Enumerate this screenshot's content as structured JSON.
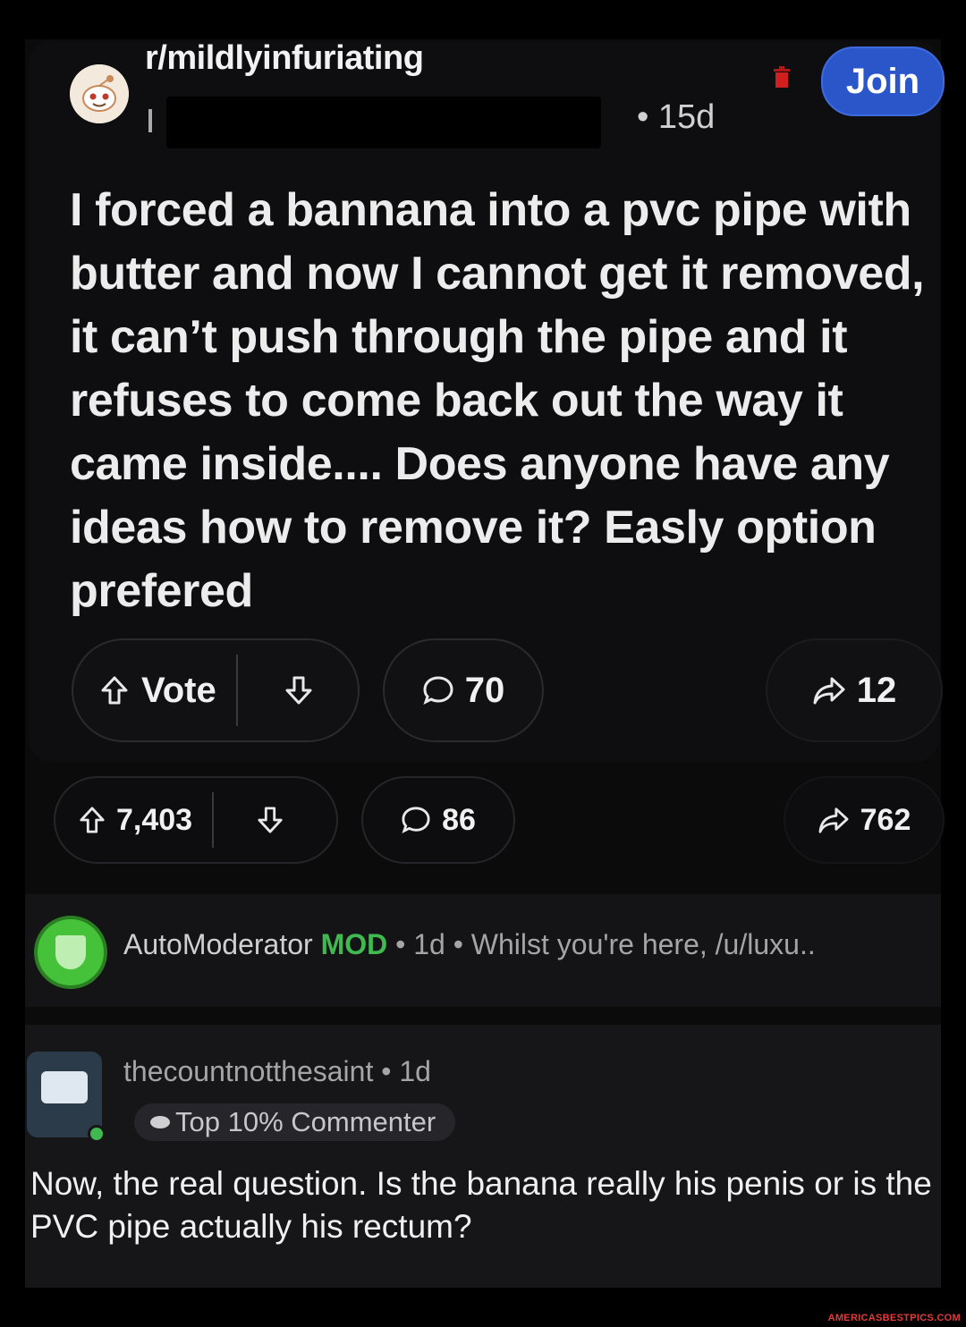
{
  "post": {
    "subreddit": "r/mildlyinfuriating",
    "age": "• 15d",
    "join_label": "Join",
    "title": "I forced a bannana into a pvc pipe with butter and now I cannot get it removed, it can’t push through the pipe and it refuses to come back out the way it came inside.... Does anyone have any ideas how to remove it? Easly option prefered",
    "vote_label": "Vote",
    "comment_count": "70",
    "share_count": "12"
  },
  "outer_post": {
    "upvotes": "7,403",
    "comment_count": "86",
    "share_count": "762"
  },
  "automod": {
    "username": "AutoModerator",
    "mod_tag": "MOD",
    "meta": " • 1d • Whilst you're here, /u/luxu.."
  },
  "comment": {
    "username": "thecountnotthesaint",
    "age": " • 1d",
    "badge": "Top 10% Commenter",
    "body": "Now, the real question. Is the banana really his penis or is the PVC pipe actually his rectum?"
  },
  "watermark": "AMERICASBESTPICS.COM",
  "colors": {
    "join_button": "#2a56c9",
    "mod_green": "#3fb950",
    "watermark_red": "#e23b3b"
  },
  "icons": [
    "reddit-snoo-icon",
    "trash-icon",
    "upvote-icon",
    "downvote-icon",
    "comment-icon",
    "share-icon",
    "shield-icon",
    "snoo-badge-icon"
  ]
}
